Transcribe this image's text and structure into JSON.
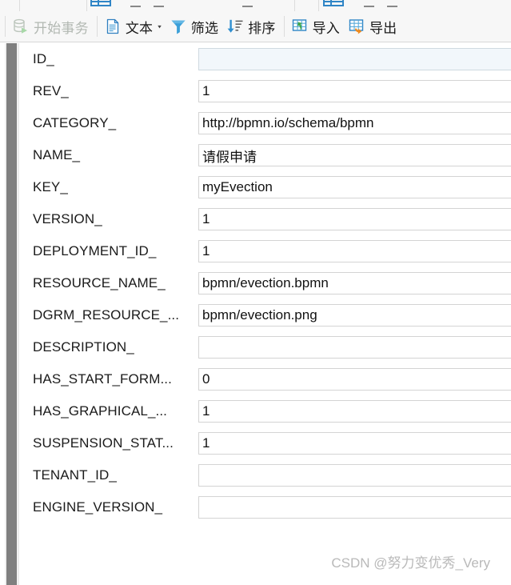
{
  "window": {
    "chrome_hint": "partially-clipped-toolbar-row"
  },
  "toolbar": {
    "items": [
      {
        "label": "开始事务",
        "icon": "begin-transaction-icon",
        "name": "begin-transaction-button",
        "disabled": true,
        "caret": false
      },
      {
        "label": "文本",
        "icon": "text-document-icon",
        "name": "text-button",
        "disabled": false,
        "caret": true
      },
      {
        "label": "筛选",
        "icon": "filter-funnel-icon",
        "name": "filter-button",
        "disabled": false,
        "caret": false
      },
      {
        "label": "排序",
        "icon": "sort-descending-icon",
        "name": "sort-button",
        "disabled": false,
        "caret": false
      },
      {
        "label": "导入",
        "icon": "import-grid-icon",
        "name": "import-button",
        "disabled": false,
        "caret": false
      },
      {
        "label": "导出",
        "icon": "export-grid-icon",
        "name": "export-button",
        "disabled": false,
        "caret": false
      }
    ]
  },
  "form": {
    "rows": [
      {
        "label": "ID_",
        "value": "",
        "focused": true,
        "cjk": false
      },
      {
        "label": "REV_",
        "value": "1",
        "focused": false,
        "cjk": false
      },
      {
        "label": "CATEGORY_",
        "value": "http://bpmn.io/schema/bpmn",
        "focused": false,
        "cjk": false
      },
      {
        "label": "NAME_",
        "value": "请假申请",
        "focused": false,
        "cjk": true
      },
      {
        "label": "KEY_",
        "value": "myEvection",
        "focused": false,
        "cjk": false
      },
      {
        "label": "VERSION_",
        "value": "1",
        "focused": false,
        "cjk": false
      },
      {
        "label": "DEPLOYMENT_ID_",
        "value": "1",
        "focused": false,
        "cjk": false
      },
      {
        "label": "RESOURCE_NAME_",
        "value": "bpmn/evection.bpmn",
        "focused": false,
        "cjk": false
      },
      {
        "label": "DGRM_RESOURCE_...",
        "value": "bpmn/evection.png",
        "focused": false,
        "cjk": false
      },
      {
        "label": "DESCRIPTION_",
        "value": "",
        "focused": false,
        "cjk": false
      },
      {
        "label": "HAS_START_FORM...",
        "value": "0",
        "focused": false,
        "cjk": false
      },
      {
        "label": "HAS_GRAPHICAL_...",
        "value": "1",
        "focused": false,
        "cjk": false
      },
      {
        "label": "SUSPENSION_STAT...",
        "value": "1",
        "focused": false,
        "cjk": false
      },
      {
        "label": "TENANT_ID_",
        "value": "",
        "focused": false,
        "cjk": false
      },
      {
        "label": "ENGINE_VERSION_",
        "value": "",
        "focused": false,
        "cjk": false
      }
    ]
  },
  "watermark": {
    "text": "CSDN @努力变优秀_Very"
  },
  "colors": {
    "accent_blue": "#3b9fd8",
    "grid_blue": "#2f85c6",
    "import_green": "#3fa64b",
    "export_orange": "#f08a1c",
    "focused_field": "#f2f7fb",
    "scrollbar_thumb": "#7f7f7f",
    "toolbar_bg": "#f7f7f7"
  }
}
